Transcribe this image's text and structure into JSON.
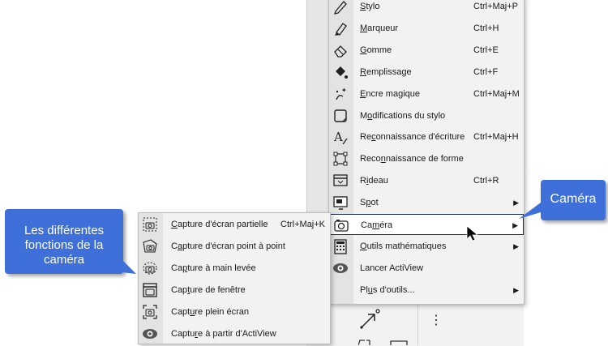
{
  "main_menu": {
    "items": [
      {
        "label": "Stylo",
        "u": "S",
        "shortcut": "Ctrl+Maj+P",
        "icon": "pen-icon"
      },
      {
        "label": "Marqueur",
        "u": "M",
        "shortcut": "Ctrl+H",
        "icon": "highlighter-icon"
      },
      {
        "label": "Gomme",
        "u": "G",
        "shortcut": "Ctrl+E",
        "icon": "eraser-icon"
      },
      {
        "label": "Remplissage",
        "u": "R",
        "shortcut": "Ctrl+F",
        "icon": "fill-bucket-icon"
      },
      {
        "label": "Encre magique",
        "u": "E",
        "shortcut": "Ctrl+Maj+M",
        "icon": "magic-ink-icon"
      },
      {
        "label": "Modifications du stylo",
        "u": "o",
        "shortcut": "",
        "icon": "pen-modifications-icon"
      },
      {
        "label": "Reconnaissance d'écriture",
        "u": "c",
        "shortcut": "Ctrl+Maj+H",
        "icon": "handwriting-recognition-icon"
      },
      {
        "label": "Reconnaissance de forme",
        "u": "n",
        "shortcut": "",
        "icon": "shape-recognition-icon"
      },
      {
        "label": "Rideau",
        "u": "i",
        "shortcut": "Ctrl+R",
        "icon": "curtain-icon"
      },
      {
        "label": "Spot",
        "u": "p",
        "shortcut": "",
        "icon": "spotlight-icon",
        "submenu": true
      },
      {
        "label": "Caméra",
        "u": "m",
        "shortcut": "",
        "icon": "camera-icon",
        "submenu": true,
        "highlighted": true
      },
      {
        "label": "Outils mathématiques",
        "u": "O",
        "shortcut": "",
        "icon": "calculator-icon",
        "submenu": true
      },
      {
        "label": "Lancer ActiView",
        "u": "",
        "shortcut": "",
        "icon": "eye-icon"
      },
      {
        "label": "Plus d'outils...",
        "u": "u",
        "shortcut": "",
        "icon": "",
        "submenu": true
      }
    ]
  },
  "sub_menu": {
    "items": [
      {
        "label": "Capture d'écran partielle",
        "u": "C",
        "shortcut": "Ctrl+Maj+K",
        "icon": "partial-capture-icon"
      },
      {
        "label": "Capture d'écran point à point",
        "u": "a",
        "shortcut": "",
        "icon": "point-capture-icon"
      },
      {
        "label": "Capture à main levée",
        "u": "p",
        "shortcut": "",
        "icon": "freehand-capture-icon"
      },
      {
        "label": "Capture de fenêtre",
        "u": "t",
        "shortcut": "",
        "icon": "window-capture-icon"
      },
      {
        "label": "Capture plein écran",
        "u": "u",
        "shortcut": "",
        "icon": "fullscreen-capture-icon"
      },
      {
        "label": "Capture à partir d'ActiView",
        "u": "r",
        "shortcut": "",
        "icon": "eye-icon"
      }
    ]
  },
  "callouts": {
    "left": [
      "Les différentes",
      "fonctions de la",
      "caméra"
    ],
    "right": "Caméra"
  },
  "colors": {
    "callout": "#3f6fd8",
    "menu_bg": "#f2f2f2",
    "gutter": "#e3e3e3"
  }
}
